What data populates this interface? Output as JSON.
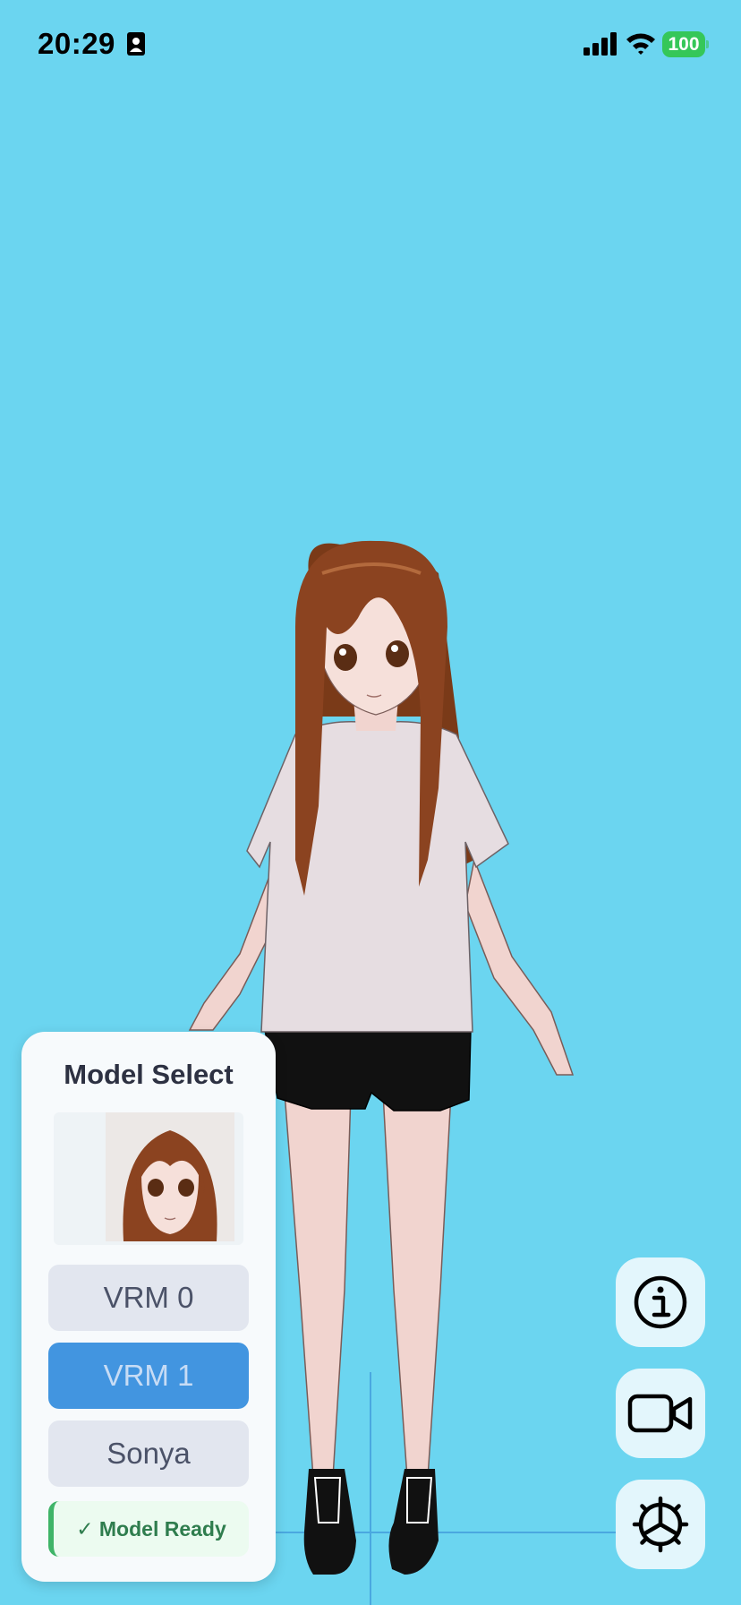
{
  "status_bar": {
    "time": "20:29",
    "battery": "100",
    "icons": [
      "id-card-icon",
      "cellular-signal-icon",
      "wifi-icon",
      "battery-icon"
    ]
  },
  "panel": {
    "title": "Model Select",
    "buttons": [
      {
        "label": "VRM 0",
        "selected": false
      },
      {
        "label": "VRM 1",
        "selected": true
      },
      {
        "label": "Sonya",
        "selected": false
      }
    ],
    "status": "✓ Model Ready"
  },
  "actions": {
    "icons": [
      "info-icon",
      "video-camera-icon",
      "settings-gear-icon"
    ]
  },
  "colors": {
    "background": "#6bd5f0",
    "accent": "#4295e0",
    "success": "#3fb468",
    "battery": "#35c759"
  }
}
